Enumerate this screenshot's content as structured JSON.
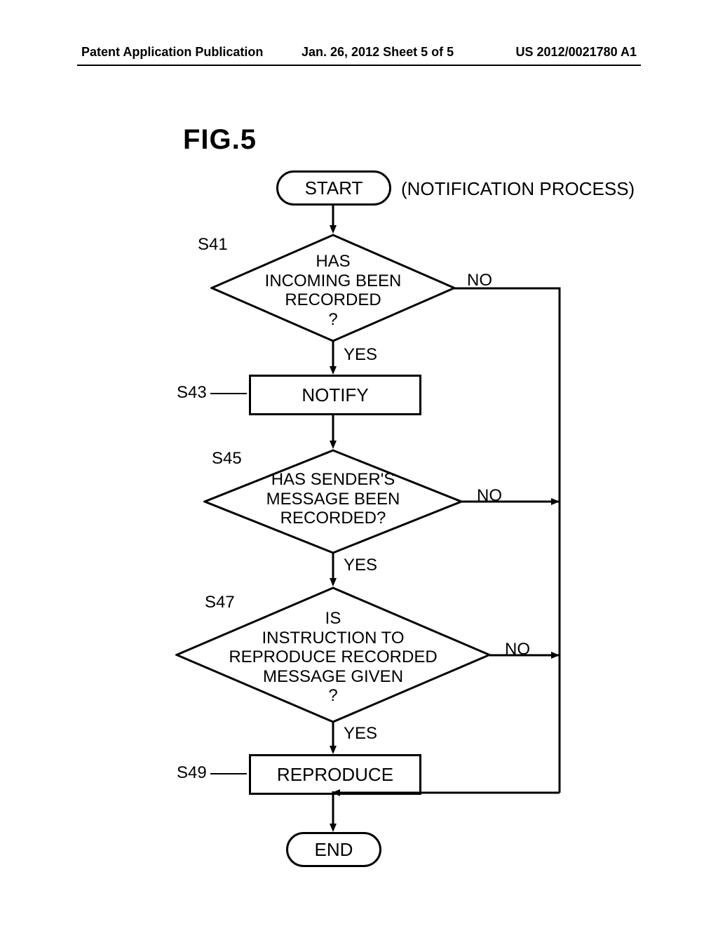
{
  "header": {
    "left": "Patent Application Publication",
    "mid": "Jan. 26, 2012  Sheet 5 of 5",
    "right": "US 2012/0021780 A1"
  },
  "figure_label": "FIG.5",
  "process_title": "(NOTIFICATION PROCESS)",
  "terminators": {
    "start": "START",
    "end": "END"
  },
  "steps": {
    "s41": {
      "ref": "S41",
      "text": "HAS INCOMING BEEN RECORDED ?"
    },
    "s43": {
      "ref": "S43",
      "text": "NOTIFY"
    },
    "s45": {
      "ref": "S45",
      "text": "HAS SENDER'S MESSAGE BEEN RECORDED?"
    },
    "s47": {
      "ref": "S47",
      "text": "IS INSTRUCTION TO REPRODUCE RECORDED MESSAGE GIVEN ?"
    },
    "s49": {
      "ref": "S49",
      "text": "REPRODUCE"
    }
  },
  "branches": {
    "yes": "YES",
    "no": "NO"
  }
}
